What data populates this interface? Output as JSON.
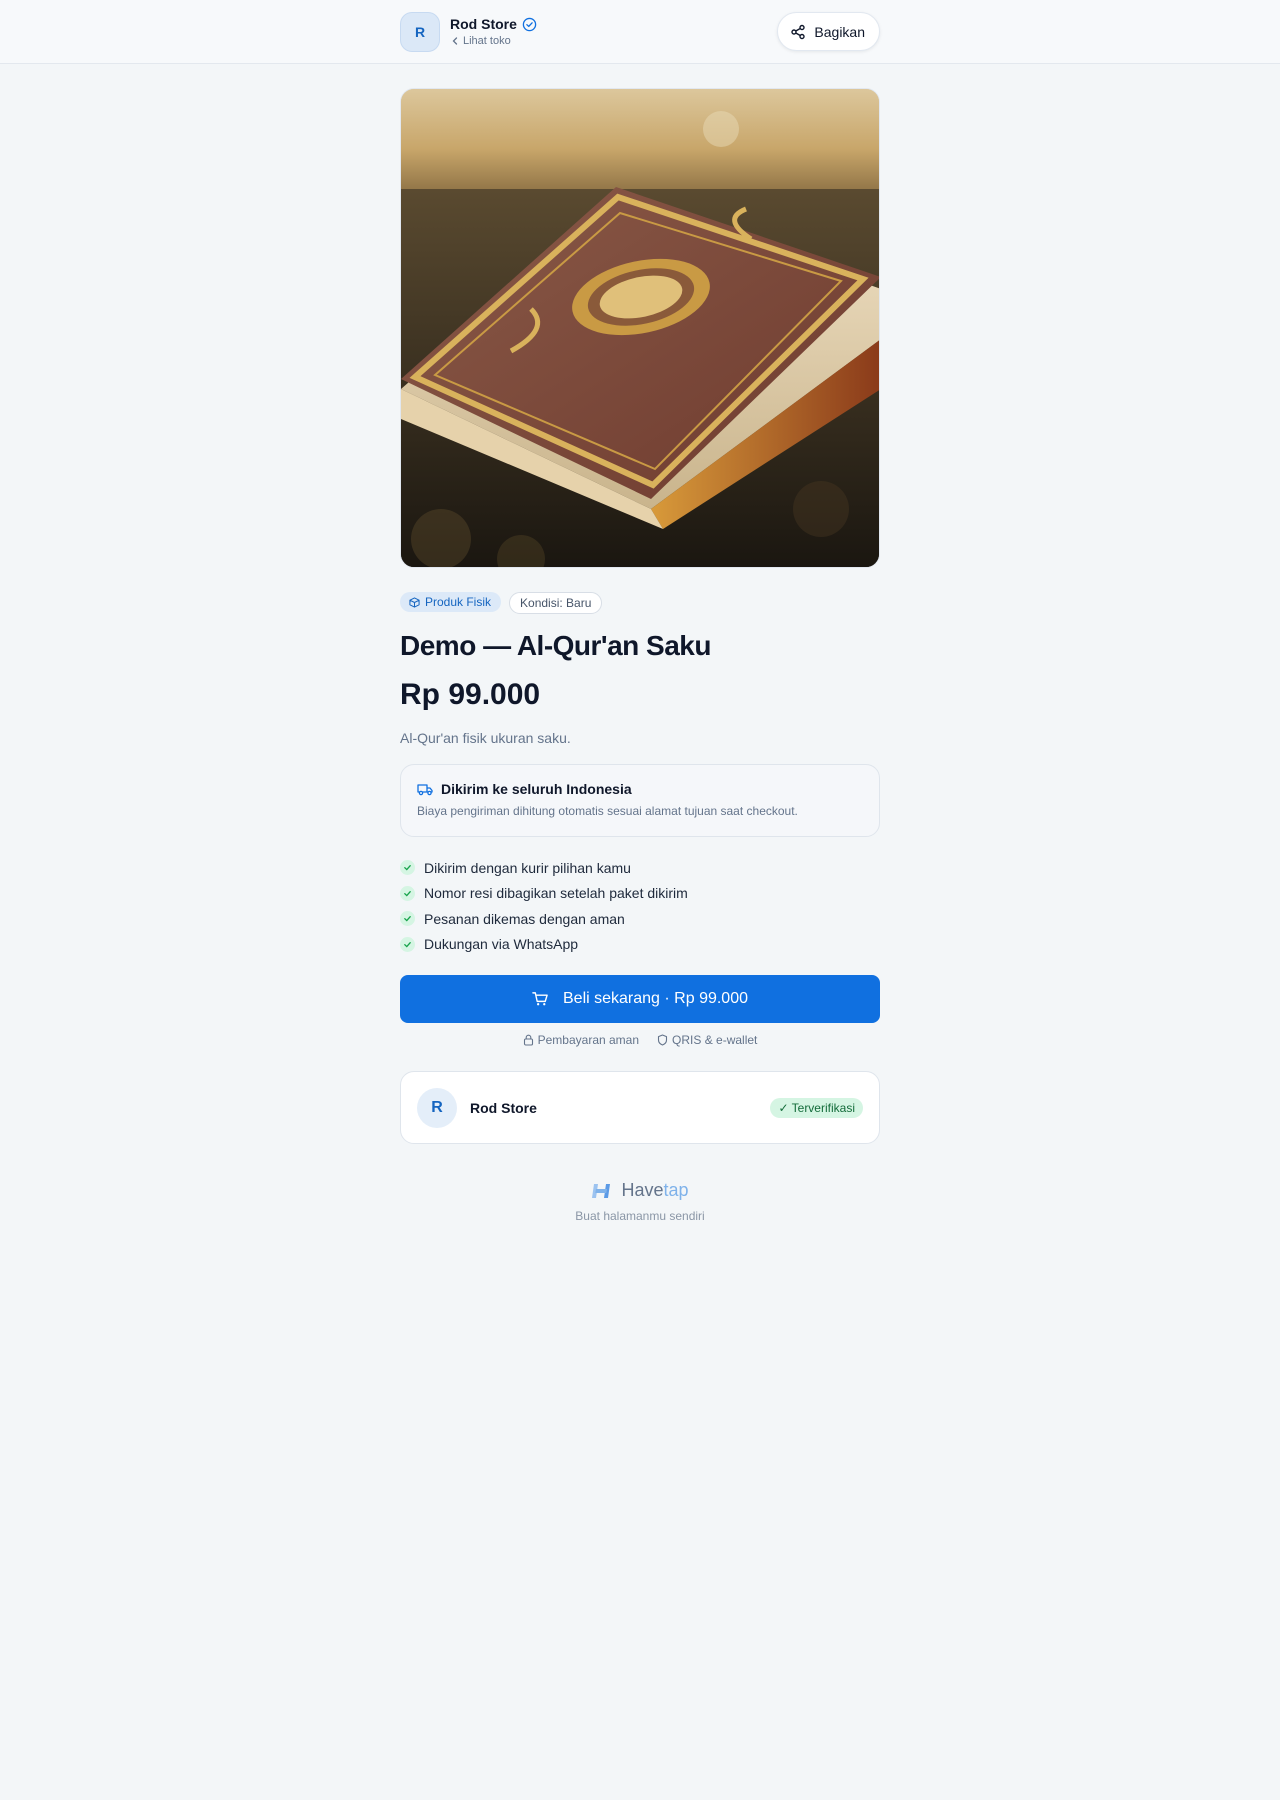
{
  "header": {
    "avatar_initial": "R",
    "store_name": "Rod Store",
    "back_label": "Lihat toko",
    "share_label": "Bagikan"
  },
  "product": {
    "image_alt": "Al-Qur'an",
    "type_chip": "Produk Fisik",
    "condition_chip": "Kondisi: Baru",
    "title": "Demo — Al-Qur'an Saku",
    "price": "Rp 99.000",
    "description": "Al-Qur'an fisik ukuran saku."
  },
  "shipping": {
    "title": "Dikirim ke seluruh Indonesia",
    "subtitle": "Biaya pengiriman dihitung otomatis sesuai alamat tujuan saat checkout."
  },
  "features": [
    "Dikirim dengan kurir pilihan kamu",
    "Nomor resi dibagikan setelah paket dikirim",
    "Pesanan dikemas dengan aman",
    "Dukungan via WhatsApp"
  ],
  "cta": {
    "buy_label": "Beli sekarang · Rp 99.000",
    "trust_secure": "Pembayaran aman",
    "trust_methods": "QRIS & e-wallet"
  },
  "store_card": {
    "avatar_initial": "R",
    "name": "Rod Store",
    "badge": "✓ Terverifikasi"
  },
  "footer": {
    "brand_part1": "Have",
    "brand_part2": "tap",
    "tagline": "Buat halamanmu sendiri"
  },
  "colors": {
    "accent": "#1070e0",
    "verified_green": "#d5f5e3",
    "background": "#f3f6f8"
  }
}
